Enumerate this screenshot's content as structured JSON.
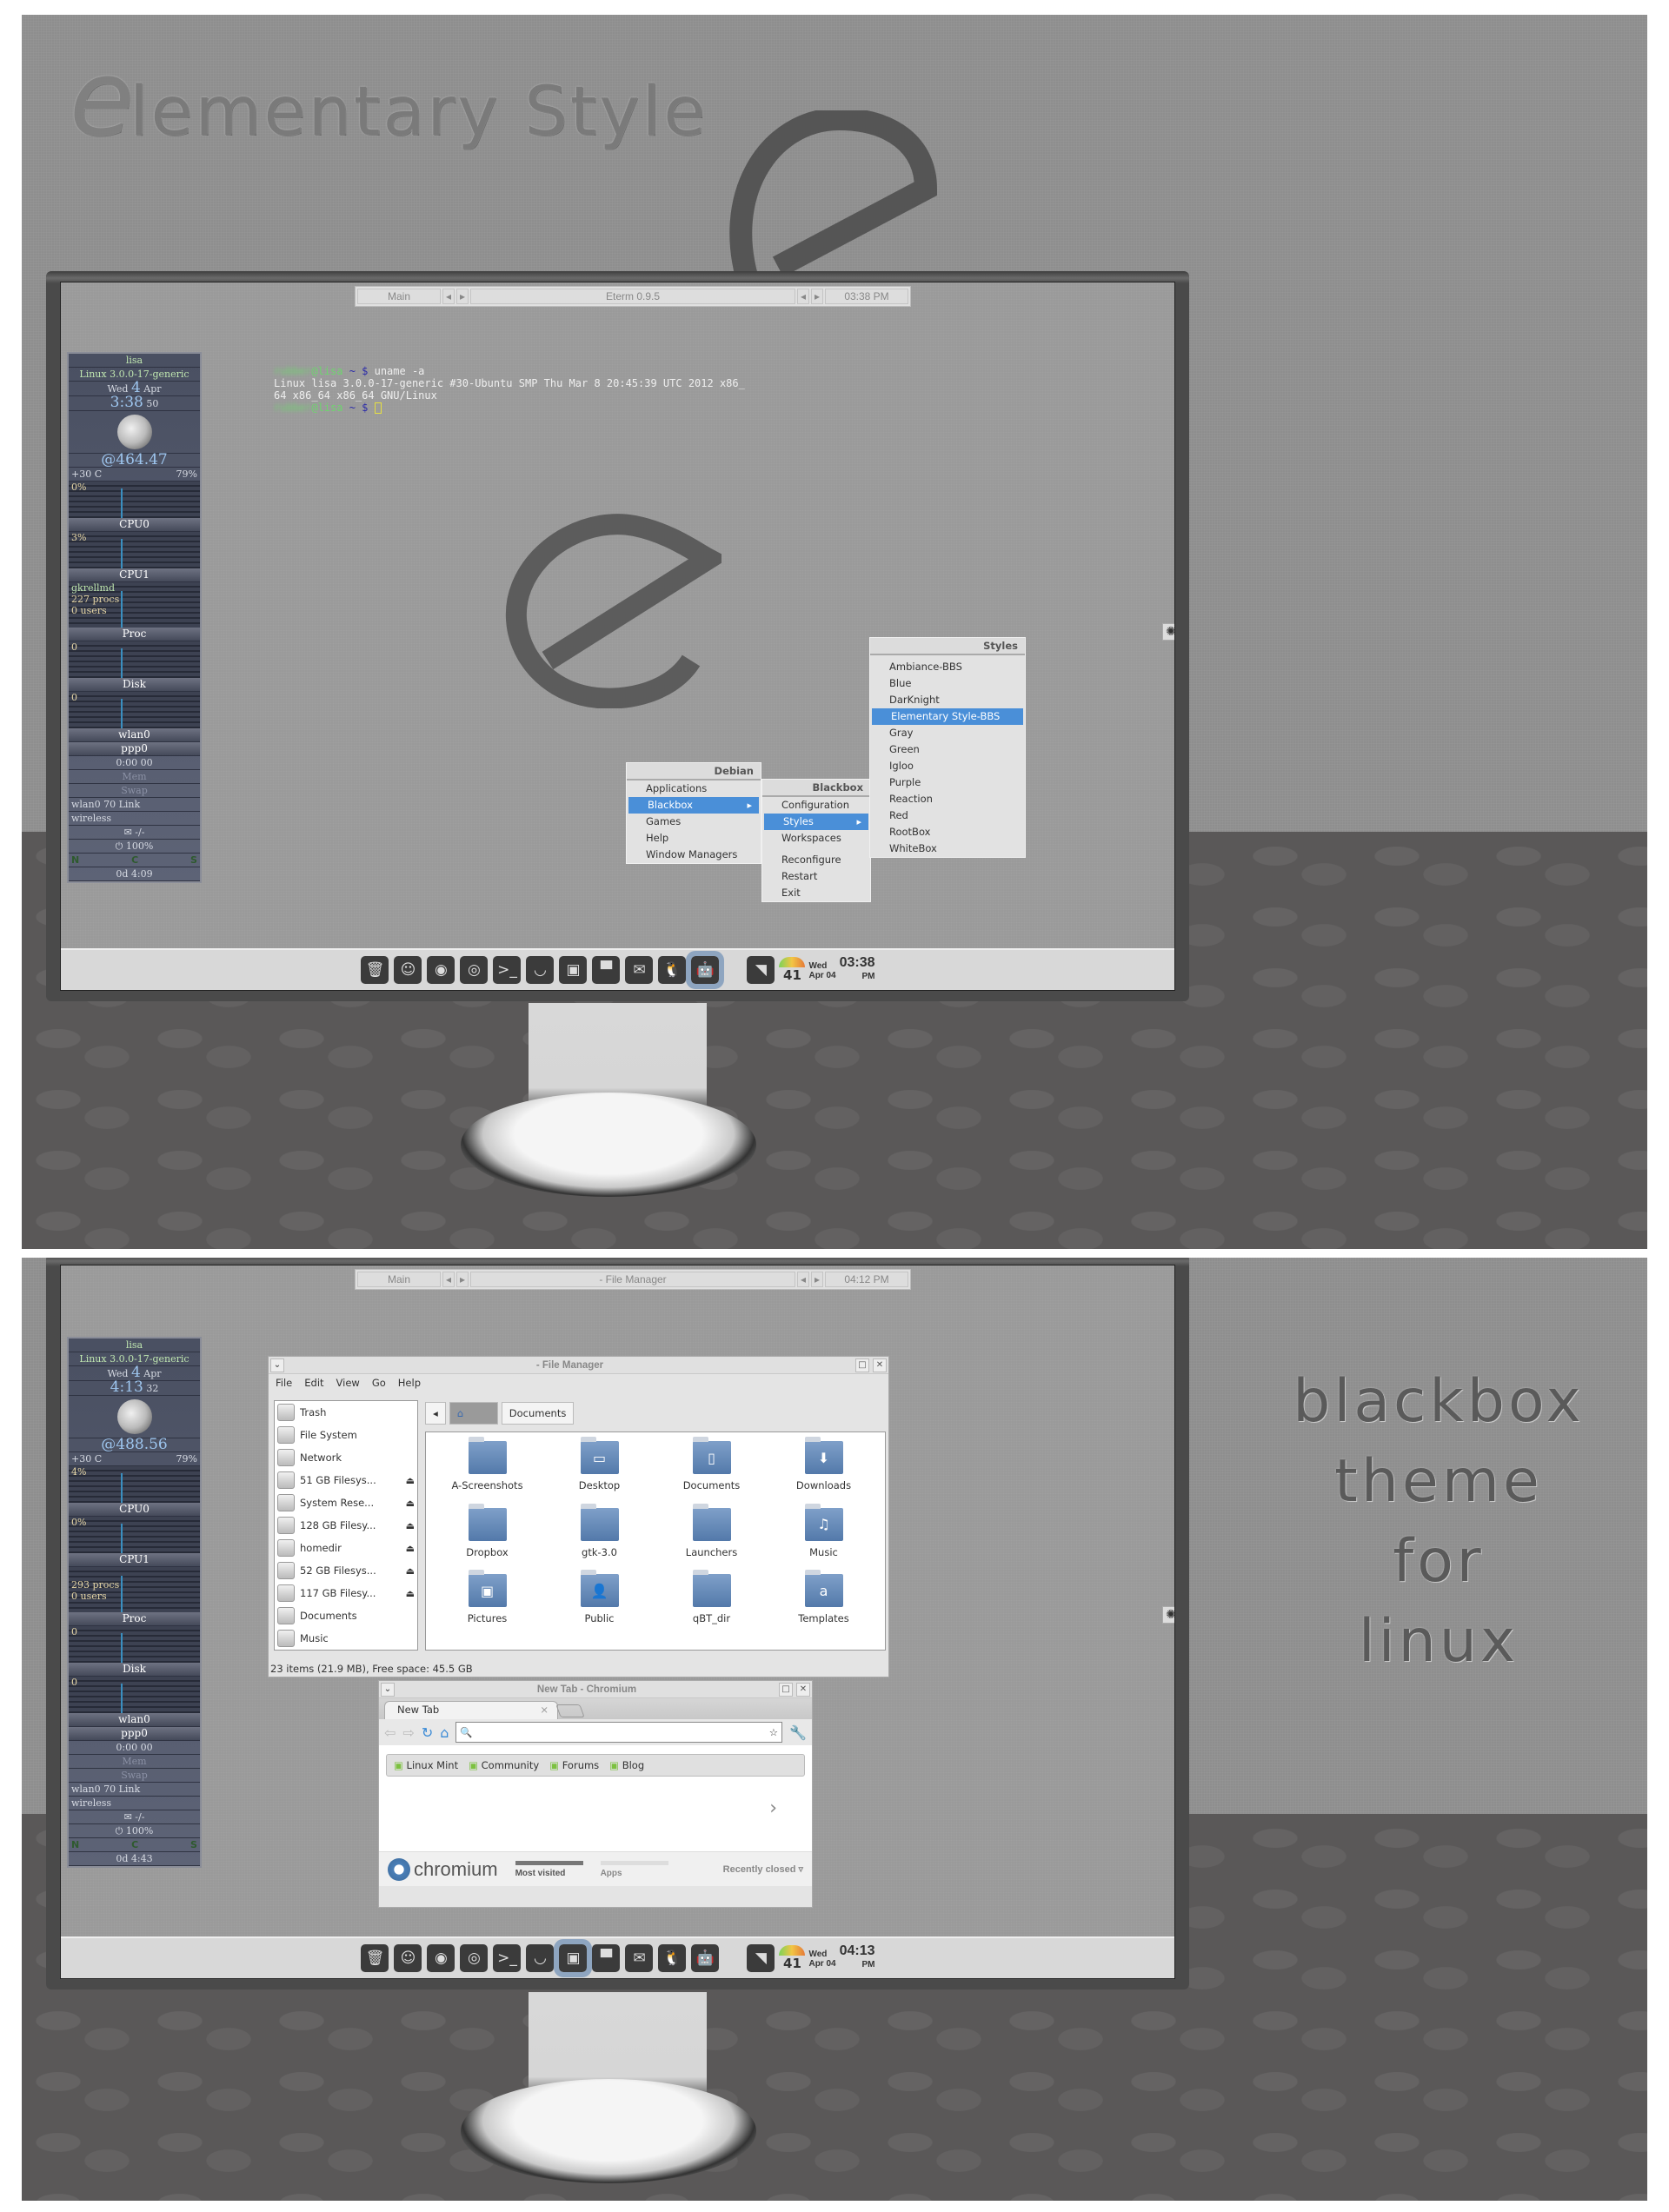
{
  "top": {
    "title_e": "e",
    "title_rest": "lementary Style",
    "eterm": {
      "main": "Main",
      "title": "Eterm 0.9.5",
      "time": "03:38 PM",
      "prev": "◂",
      "next": "▸"
    },
    "gkrellm": {
      "host": "lisa",
      "kernel": "Linux 3.0.0-17-generic",
      "day": "Wed",
      "date": "4",
      "month": "Apr",
      "time": "3:38",
      "seconds": "50",
      "beats": "@464.47",
      "temp": "+30 C",
      "battery_pct": "79%",
      "cpu0_label": "CPU0",
      "cpu0_val": "0%",
      "cpu1_label": "CPU1",
      "cpu1_val": "3%",
      "proc_name": "gkrellmd",
      "procs": "227 procs",
      "users": "0 users",
      "proc_label": "Proc",
      "proc_val": "0",
      "disk_label": "Disk",
      "disk_val": "0",
      "wlan": "wlan0",
      "ppp": "ppp0",
      "ppp_time": "0:00  00",
      "mem": "Mem",
      "swap": "Swap",
      "wireless_link": "wlan0 70 Link",
      "wireless": "wireless",
      "mail": "-/-",
      "power": "100%",
      "keys": [
        "N",
        "C",
        "S"
      ],
      "uptime": "0d  4:09"
    },
    "terminal": {
      "prompt_user": "rubber",
      "prompt_host": "@lisa",
      "prompt_path": " ~ $ ",
      "command": "uname -a",
      "output1": "Linux lisa 3.0.0-17-generic #30-Ubuntu SMP Thu Mar 8 20:45:39 UTC 2012 x86_",
      "output2": "64 x86_64 x86_64 GNU/Linux"
    },
    "menu_debian": {
      "title": "Debian",
      "items": [
        "Applications",
        "Blackbox",
        "Games",
        "Help",
        "Window Managers"
      ]
    },
    "menu_blackbox": {
      "title": "Blackbox",
      "items": [
        "Configuration",
        "Styles",
        "Workspaces",
        "Reconfigure",
        "Restart",
        "Exit"
      ]
    },
    "menu_styles": {
      "title": "Styles",
      "items": [
        "Ambiance-BBS",
        "Blue",
        "DarKnight",
        "Elementary Style-BBS",
        "Gray",
        "Green",
        "Igloo",
        "Purple",
        "Reaction",
        "Red",
        "RootBox",
        "WhiteBox"
      ],
      "selected": "Elementary Style-BBS"
    },
    "taskbar": {
      "temp": "41",
      "day": "Wed",
      "date": "Apr 04",
      "time": "03:38",
      "ampm": "PM",
      "active": "android"
    }
  },
  "bottom": {
    "eterm": {
      "main": "Main",
      "title": "- File Manager",
      "time": "04:12 PM",
      "prev": "◂",
      "next": "▸"
    },
    "gkrellm": {
      "host": "lisa",
      "kernel": "Linux 3.0.0-17-generic",
      "day": "Wed",
      "date": "4",
      "month": "Apr",
      "time": "4:13",
      "seconds": "32",
      "beats": "@488.56",
      "temp": "+30 C",
      "battery_pct": "79%",
      "cpu0_label": "CPU0",
      "cpu0_val": "4%",
      "cpu1_label": "CPU1",
      "cpu1_val": "0%",
      "procs": "293 procs",
      "users": "0 users",
      "proc_label": "Proc",
      "proc_val": "0",
      "disk_label": "Disk",
      "disk_val": "0",
      "wlan": "wlan0",
      "ppp": "ppp0",
      "ppp_time": "0:00  00",
      "mem": "Mem",
      "swap": "Swap",
      "wireless_link": "wlan0 70 Link",
      "wireless": "wireless",
      "mail": "-/-",
      "power": "100%",
      "keys": [
        "N",
        "C",
        "S"
      ],
      "uptime": "0d  4:43"
    },
    "file_manager": {
      "title": "- File Manager",
      "menu": [
        "File",
        "Edit",
        "View",
        "Go",
        "Help"
      ],
      "sidebar": [
        {
          "name": "Trash",
          "eject": false
        },
        {
          "name": "File System",
          "eject": false
        },
        {
          "name": "Network",
          "eject": false
        },
        {
          "name": "51 GB Filesys...",
          "eject": true
        },
        {
          "name": "System Rese...",
          "eject": true
        },
        {
          "name": "128 GB Filesy...",
          "eject": true
        },
        {
          "name": "homedir",
          "eject": true
        },
        {
          "name": "52 GB Filesys...",
          "eject": true
        },
        {
          "name": "117 GB Filesy...",
          "eject": true
        },
        {
          "name": "Documents",
          "eject": false
        },
        {
          "name": "Music",
          "eject": false
        }
      ],
      "path_current": "Documents",
      "files": [
        {
          "name": "A-Screenshots",
          "glyph": ""
        },
        {
          "name": "Desktop",
          "glyph": "▭"
        },
        {
          "name": "Documents",
          "glyph": "▯"
        },
        {
          "name": "Downloads",
          "glyph": "⬇"
        },
        {
          "name": "Dropbox",
          "glyph": ""
        },
        {
          "name": "gtk-3.0",
          "glyph": ""
        },
        {
          "name": "Launchers",
          "glyph": ""
        },
        {
          "name": "Music",
          "glyph": "♫"
        },
        {
          "name": "Pictures",
          "glyph": "▣"
        },
        {
          "name": "Public",
          "glyph": "👤"
        },
        {
          "name": "qBT_dir",
          "glyph": ""
        },
        {
          "name": "Templates",
          "glyph": "a"
        }
      ],
      "status": "23 items (21.9 MB), Free space: 45.5 GB",
      "eject_glyph": "⏏"
    },
    "chromium": {
      "title": "New Tab - Chromium",
      "tab_label": "New Tab",
      "bookmarks": [
        "Linux Mint",
        "Community",
        "Forums",
        "Blog"
      ],
      "logo_text": "chromium",
      "footer_tabs": [
        "Most visited",
        "Apps"
      ],
      "recently_closed": "Recently closed ▿"
    },
    "caption": [
      "blackbox",
      "theme",
      "for",
      "linux"
    ],
    "taskbar": {
      "temp": "41",
      "day": "Wed",
      "date": "Apr 04",
      "time": "04:13",
      "ampm": "PM",
      "active": "file-manager"
    }
  },
  "dock_icons": [
    {
      "name": "trash",
      "glyph": "🗑"
    },
    {
      "name": "finder",
      "glyph": "☺"
    },
    {
      "name": "firefox",
      "glyph": "◉"
    },
    {
      "name": "chrome",
      "glyph": "◎"
    },
    {
      "name": "terminal",
      "glyph": ">_"
    },
    {
      "name": "gimp",
      "glyph": "◡"
    },
    {
      "name": "file-manager",
      "glyph": "▣"
    },
    {
      "name": "box",
      "glyph": "▀"
    },
    {
      "name": "thunderbird",
      "glyph": "✉"
    },
    {
      "name": "tux",
      "glyph": "🐧"
    },
    {
      "name": "android",
      "glyph": "🤖"
    }
  ],
  "rss_glyph": "◥",
  "gear_glyph": "✺"
}
